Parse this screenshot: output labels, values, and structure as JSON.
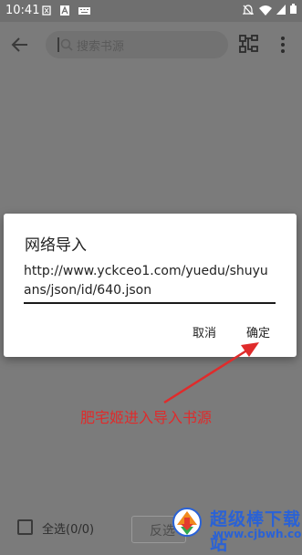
{
  "status_bar": {
    "time": "10:41"
  },
  "search": {
    "placeholder": "搜索书源"
  },
  "bottom": {
    "select_all_label": "全选(0/0)",
    "invert_label": "反选"
  },
  "dialog": {
    "title": "网络导入",
    "url_value": "http://www.yckceo1.com/yuedu/shuyuans/json/id/640.json",
    "cancel_label": "取消",
    "ok_label": "确定"
  },
  "annotation": {
    "text": "肥宅姬进入导入书源",
    "color": "#e02b2b"
  },
  "watermark": {
    "brand_text": "超级棒下载站",
    "url_text": "www.cjbwh.com"
  },
  "colors": {
    "overlay": "#7b7b7b",
    "dialog_bg": "#ffffff",
    "annotation_red": "#e02b2b",
    "watermark_blue": "#2a62d6"
  }
}
